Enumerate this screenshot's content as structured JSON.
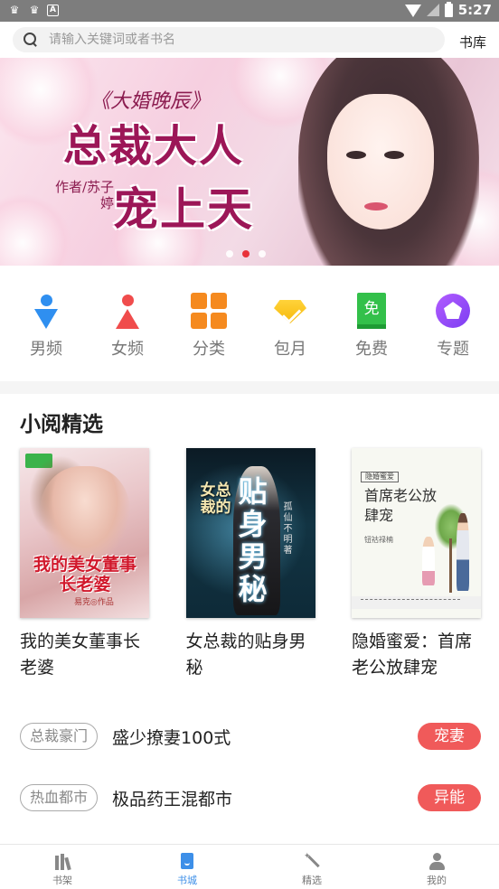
{
  "status_bar": {
    "time": "5:27",
    "icon_names": [
      "notification-icon",
      "notification-icon",
      "a-icon",
      "wifi-icon",
      "signal-icon",
      "battery-icon"
    ]
  },
  "search": {
    "placeholder": "请输入关键词或者书名",
    "library_label": "书库"
  },
  "banner": {
    "series_text": "《大婚晚辰》",
    "title_line1": "总裁大人",
    "title_line2": "宠上天",
    "author_text": "作者/苏子婷",
    "slide_count": 3,
    "active_slide": 2,
    "active_dot_color": "#e8323a"
  },
  "categories": [
    {
      "label": "男频",
      "icon": "male-icon"
    },
    {
      "label": "女频",
      "icon": "female-icon"
    },
    {
      "label": "分类",
      "icon": "grid-icon"
    },
    {
      "label": "包月",
      "icon": "diamond-icon"
    },
    {
      "label": "免费",
      "icon": "free-icon",
      "icon_text": "免"
    },
    {
      "label": "专题",
      "icon": "topic-icon"
    }
  ],
  "featured": {
    "title": "小阅精选",
    "books": [
      {
        "name": "我的美女董事长老婆",
        "cover_title": "我的美女董事长老婆",
        "cover_author": "易克◎作品"
      },
      {
        "name": "女总裁的贴身男秘",
        "cover_title_small": "女总裁的",
        "cover_title_big": "贴身男秘",
        "cover_author": "孤仙不明著"
      },
      {
        "name": "隐婚蜜爱：首席老公放肆宠",
        "cover_tag": "隐婚蜜爱",
        "cover_title": "首席老公放肆宠",
        "cover_author": "钮祜禄楠"
      }
    ]
  },
  "tag_rows": [
    {
      "tag": "总裁豪门",
      "title": "盛少撩妻100式",
      "badge": "宠妻"
    },
    {
      "tag": "热血都市",
      "title": "极品药王混都市",
      "badge": "异能"
    }
  ],
  "tabbar": {
    "active": "书城",
    "accent_color": "#3d8fe8",
    "tabs": [
      {
        "label": "书架",
        "icon": "bookshelf-icon"
      },
      {
        "label": "书城",
        "icon": "bookstore-icon"
      },
      {
        "label": "精选",
        "icon": "magic-wand-icon"
      },
      {
        "label": "我的",
        "icon": "profile-icon"
      }
    ]
  }
}
